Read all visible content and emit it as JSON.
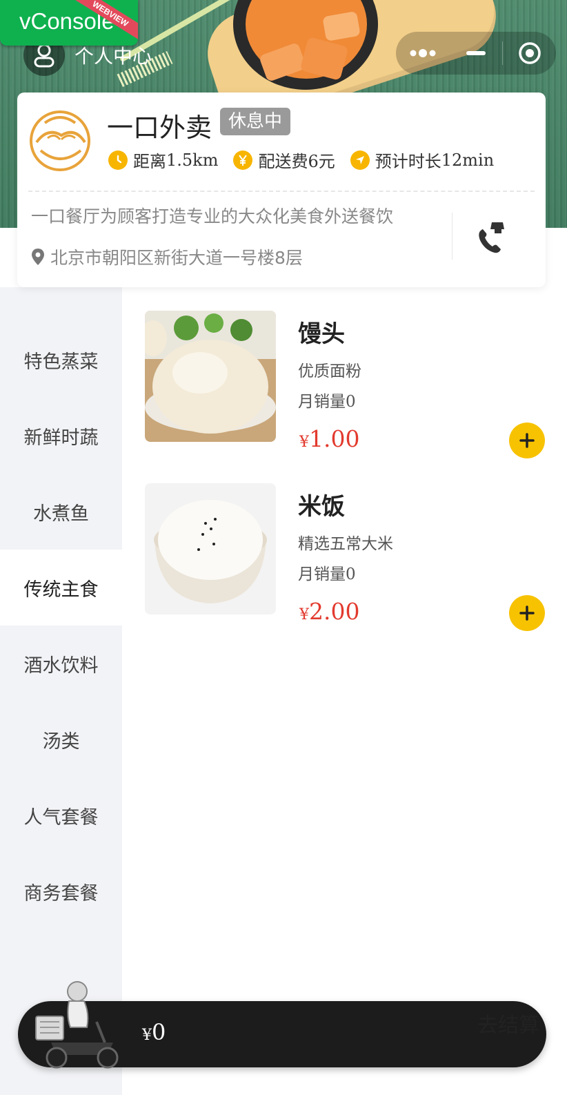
{
  "debug": {
    "vconsole_label": "vConsole",
    "vconsole_ribbon": "WEBVIEW"
  },
  "header": {
    "profile_label": "个人中心"
  },
  "shop": {
    "name": "一口外卖",
    "status": "休息中",
    "distance_label": "距离",
    "distance_value": "1.5km",
    "fee_label": "配送费",
    "fee_value": "6元",
    "eta_label": "预计时长",
    "eta_value": "12min",
    "description": "一口餐厅为顾客打造专业的大众化美食外送餐饮",
    "address": "北京市朝阳区新街大道一号楼8层"
  },
  "categories": [
    {
      "label": "特色蒸菜",
      "active": false
    },
    {
      "label": "新鲜时蔬",
      "active": false
    },
    {
      "label": "水煮鱼",
      "active": false
    },
    {
      "label": "传统主食",
      "active": true
    },
    {
      "label": "酒水饮料",
      "active": false
    },
    {
      "label": "汤类",
      "active": false
    },
    {
      "label": "人气套餐",
      "active": false
    },
    {
      "label": "商务套餐",
      "active": false
    }
  ],
  "foods": [
    {
      "name": "馒头",
      "desc": "优质面粉",
      "sales_label": "月销量",
      "sales": "0",
      "currency": "¥",
      "price": "1.00"
    },
    {
      "name": "米饭",
      "desc": "精选五常大米",
      "sales_label": "月销量",
      "sales": "0",
      "currency": "¥",
      "price": "2.00"
    }
  ],
  "cart": {
    "currency": "¥",
    "total": "0",
    "checkout": "去结算"
  },
  "colors": {
    "accent": "#f7c200",
    "price": "#e23a2e",
    "cart_bg": "#1c1c1c",
    "sidebar_bg": "#f2f3f6"
  }
}
